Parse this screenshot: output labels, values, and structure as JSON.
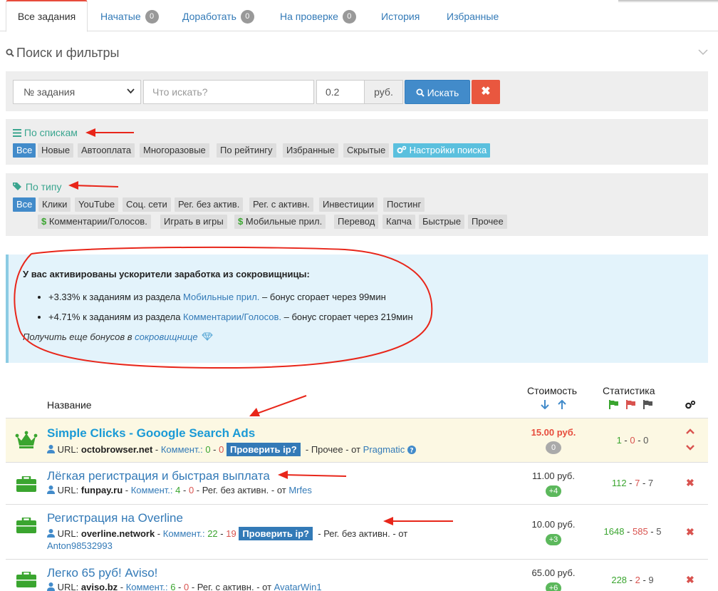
{
  "tabs": [
    {
      "label": "Все задания"
    },
    {
      "label": "Начатые",
      "badge": "0"
    },
    {
      "label": "Доработать",
      "badge": "0"
    },
    {
      "label": "На проверке",
      "badge": "0"
    },
    {
      "label": "История"
    },
    {
      "label": "Избранные"
    }
  ],
  "search": {
    "title": "Поиск и фильтры",
    "select_value": "№ задания",
    "query_placeholder": "Что искать?",
    "min_price": "0.2",
    "currency": "руб.",
    "search_button": "Искать",
    "clear_button": "✖"
  },
  "lists": {
    "title": "По спискам",
    "items": [
      "Все",
      "Новые",
      "Автооплата",
      "Многоразовые",
      "По рейтингу",
      "Избранные",
      "Скрытые"
    ],
    "settings": "Настройки поиска"
  },
  "types": {
    "title": "По типу",
    "row1": [
      "Все",
      "Клики",
      "YouTube",
      "Соц. сети",
      "Рег. без актив.",
      "Рег. с активн.",
      "Инвестиции",
      "Постинг"
    ],
    "row2": [
      "Комментарии/Голосов.",
      "Играть в игры",
      "Мобильные прил.",
      "Перевод",
      "Капча",
      "Быстрые",
      "Прочее"
    ]
  },
  "boost": {
    "title": "У вас активированы ускорители заработка из сокровищницы:",
    "items": [
      {
        "pre": "+3.33% к заданиям из раздела ",
        "link": "Мобильные прил.",
        "post": " – бонус сгорает через 99мин"
      },
      {
        "pre": "+4.71% к заданиям из раздела ",
        "link": "Комментарии/Голосов.",
        "post": " – бонус сгорает через 219мин"
      }
    ],
    "more_pre": "Получить еще бонусов в ",
    "more_link": "сокровищнице"
  },
  "table": {
    "col_name": "Название",
    "col_price": "Стоимость",
    "col_stats": "Статистика",
    "rows": [
      {
        "title": "Simple Clicks - Gooogle Search Ads",
        "url": "octobrowser.net",
        "comm_label": "Коммент.:",
        "c1": "0",
        "c2": "0",
        "check_ip": "Проверить ip?",
        "category": "Прочее",
        "author_pre": "- от ",
        "author": "Pragmatic",
        "price": "15.00 руб.",
        "badge": "0",
        "s1": "1",
        "s2": "0",
        "s3": "0"
      },
      {
        "title": "Лёгкая регистрация и быстрая выплата",
        "url": "funpay.ru",
        "comm_label": "Коммент.:",
        "c1": "4",
        "c2": "0",
        "category": "Рег. без активн.",
        "author_pre": "- от ",
        "author": "Mrfes",
        "price": "11.00 руб.",
        "badge": "+4",
        "s1": "112",
        "s2": "7",
        "s3": "7"
      },
      {
        "title": "Регистрация на Overline",
        "url": "overline.network",
        "comm_label": "Коммент.:",
        "c1": "22",
        "c2": "19",
        "check_ip": "Проверить ip?",
        "category": "Рег. без активн.",
        "author_pre": "- от",
        "author": "Anton98532993",
        "price": "10.00 руб.",
        "badge": "+3",
        "s1": "1648",
        "s2": "585",
        "s3": "5"
      },
      {
        "title": "Легко 65 руб! Aviso!",
        "url": "aviso.bz",
        "comm_label": "Коммент.:",
        "c1": "6",
        "c2": "0",
        "category": "Рег. с активн.",
        "author_pre": "- от ",
        "author": "AvatarWin1",
        "price": "65.00 руб.",
        "badge": "+6",
        "s1": "228",
        "s2": "2",
        "s3": "9"
      }
    ]
  },
  "url_label": "URL:",
  "colors": {
    "accent": "#337ab7",
    "green": "#3aa52f",
    "red": "#d9534f",
    "teal": "#3aa58f",
    "annotation": "#e8261a"
  }
}
